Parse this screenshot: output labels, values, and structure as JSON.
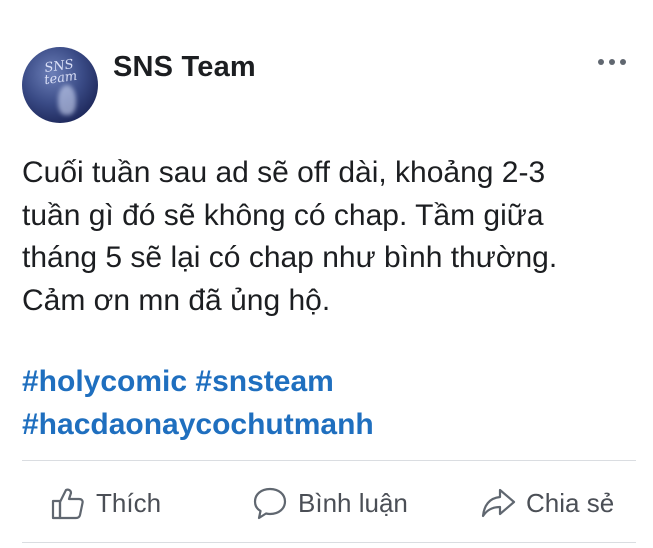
{
  "post": {
    "author": {
      "name": "SNS Team",
      "avatar_text": "SNS team"
    },
    "text_lines": [
      "Cuối tuần sau ad sẽ off dài, khoảng 2-3",
      "tuần gì đó sẽ không có chap. Tầm giữa",
      "tháng 5 sẽ lại có chap như bình thường.",
      "Cảm ơn mn đã ủng hộ."
    ],
    "hashtags": [
      "#holycomic",
      "#snsteam",
      "#hacdaonaycochutmanh"
    ],
    "hashtag_color": "#1f6fbf"
  },
  "actions": {
    "like_label": "Thích",
    "comment_label": "Bình luận",
    "share_label": "Chia sẻ"
  },
  "icons": {
    "more": "more-dots-icon",
    "like": "thumbs-up-icon",
    "comment": "comment-bubble-icon",
    "share": "share-arrow-icon"
  }
}
